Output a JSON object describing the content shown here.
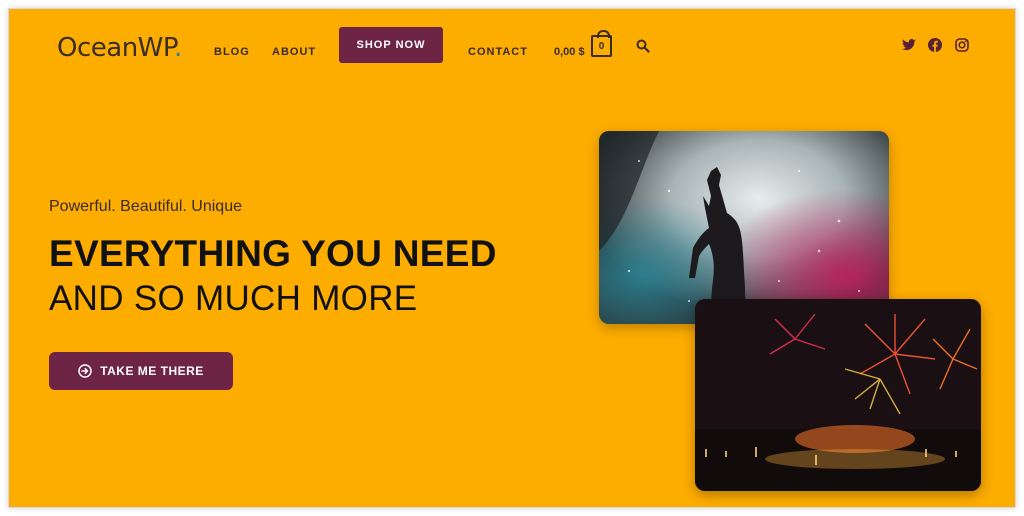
{
  "brand": {
    "name": "OceanWP",
    "dot": "."
  },
  "nav": {
    "blog": "BLOG",
    "about": "ABOUT",
    "shop_now": "SHOP NOW",
    "contact": "CONTACT",
    "cart_amount": "0,00 $",
    "cart_count": "0"
  },
  "social_icons": [
    "twitter-icon",
    "facebook-icon",
    "instagram-icon"
  ],
  "hero": {
    "tagline": "Powerful. Beautiful. Unique",
    "headline_bold": "EVERYTHING YOU NEED",
    "headline_light": "AND SO MUCH MORE",
    "cta_label": "TAKE ME THERE",
    "cta_icon": "arrow-circle-right-icon"
  },
  "colors": {
    "background": "#FDAC00",
    "accent": "#6E2445",
    "text_dark": "#111111"
  }
}
